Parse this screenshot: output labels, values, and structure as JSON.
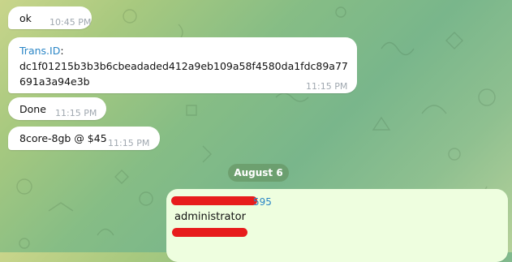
{
  "messages": [
    {
      "text": "ok",
      "time": "10:45 PM"
    },
    {
      "label": "Trans.ID",
      "suffix": ":",
      "text": "dc1f01215b3b3b6cbeadaded412a9eb109a58f4580da1fdc89a77691a3a94e3b",
      "time": "11:15 PM"
    },
    {
      "text": "Done",
      "time": "11:15 PM"
    },
    {
      "text": "8core-8gb @ $45",
      "time": "11:15 PM"
    }
  ],
  "date_separator": "August 6",
  "reply": {
    "sender_suffix": "595",
    "text": "administrator"
  },
  "colors": {
    "link": "#2b86c6",
    "redaction": "#e71c1c",
    "outgoing_bubble": "#eefedf"
  }
}
